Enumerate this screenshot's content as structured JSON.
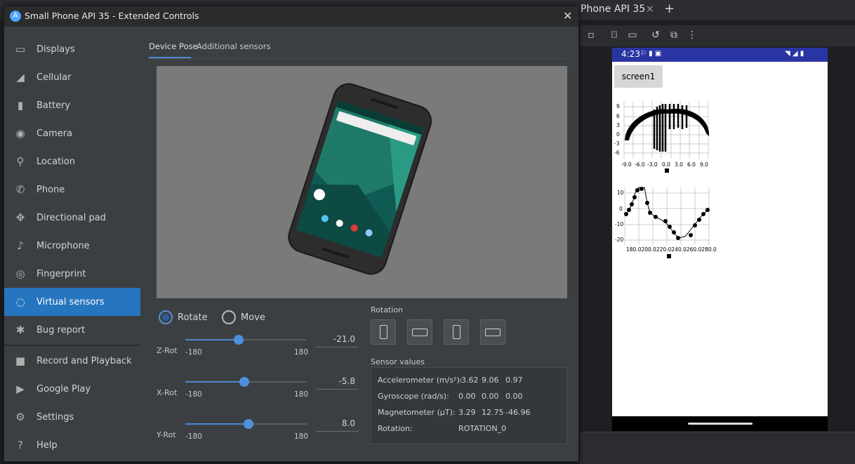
{
  "ide": {
    "tab_title": "Phone API 35",
    "tab_close": "×",
    "tab_add": "+",
    "toolbar_icons": [
      "stop-icon",
      "camera-icon",
      "video-icon",
      "rotate-icon",
      "screenshot-icon",
      "more-icon"
    ]
  },
  "phone": {
    "time": "4:23",
    "button_label": "screen1",
    "chart1": {
      "y_ticks": [
        "9",
        "6",
        "3",
        "0",
        "-3",
        "-6"
      ],
      "x_ticks": [
        "-9.0",
        "-6.0",
        "-3.0",
        "0.0",
        "3.0",
        "6.0",
        "9.0"
      ]
    },
    "chart2": {
      "y_ticks": [
        "10",
        "0",
        "-10",
        "-20"
      ],
      "x_ticks": [
        "180.0",
        "200.0",
        "220.0",
        "240.0",
        "260.0",
        "280.0"
      ],
      "x_axis_text": "180.0200.0220.0240.0260.0280.0"
    }
  },
  "window": {
    "title": "Small Phone API 35 - Extended Controls",
    "close": "✕"
  },
  "sidebar": {
    "items": [
      {
        "label": "Displays",
        "icon": "display-icon"
      },
      {
        "label": "Cellular",
        "icon": "cellular-icon"
      },
      {
        "label": "Battery",
        "icon": "battery-icon"
      },
      {
        "label": "Camera",
        "icon": "camera-icon"
      },
      {
        "label": "Location",
        "icon": "location-icon"
      },
      {
        "label": "Phone",
        "icon": "phone-icon"
      },
      {
        "label": "Directional pad",
        "icon": "dpad-icon"
      },
      {
        "label": "Microphone",
        "icon": "microphone-icon"
      },
      {
        "label": "Fingerprint",
        "icon": "fingerprint-icon"
      },
      {
        "label": "Virtual sensors",
        "icon": "sensors-icon",
        "active": true
      },
      {
        "label": "Bug report",
        "icon": "bug-icon"
      },
      {
        "label": "Record and Playback",
        "icon": "record-icon"
      },
      {
        "label": "Google Play",
        "icon": "play-icon"
      },
      {
        "label": "Settings",
        "icon": "gear-icon"
      },
      {
        "label": "Help",
        "icon": "help-icon"
      }
    ]
  },
  "tabs": {
    "device_pose": "Device Pose",
    "additional_sensors": "Additional sensors"
  },
  "mode": {
    "rotate": "Rotate",
    "move": "Move",
    "selected": "Rotate"
  },
  "sliders": [
    {
      "label": "Z-Rot",
      "min": "-180",
      "max": "180",
      "value": "-21.0",
      "numeric": -21.0
    },
    {
      "label": "X-Rot",
      "min": "-180",
      "max": "180",
      "value": "-5.8",
      "numeric": -5.8
    },
    {
      "label": "Y-Rot",
      "min": "-180",
      "max": "180",
      "value": "8.0",
      "numeric": 8.0
    }
  ],
  "rotation": {
    "heading": "Rotation",
    "buttons": [
      "portrait",
      "landscape",
      "reverse-portrait",
      "reverse-landscape"
    ]
  },
  "sensor_values": {
    "heading": "Sensor values",
    "accelerometer": {
      "label": "Accelerometer (m/s²):",
      "values": [
        "-3.62",
        "9.06",
        "0.97"
      ]
    },
    "gyroscope": {
      "label": "Gyroscope (rad/s):",
      "values": [
        "0.00",
        "0.00",
        "0.00"
      ]
    },
    "magnetometer": {
      "label": "Magnetometer (µT):",
      "values": [
        "3.29",
        "12.75",
        "-46.96"
      ]
    },
    "rotation": {
      "label": "Rotation:",
      "value": "ROTATION_0"
    }
  }
}
